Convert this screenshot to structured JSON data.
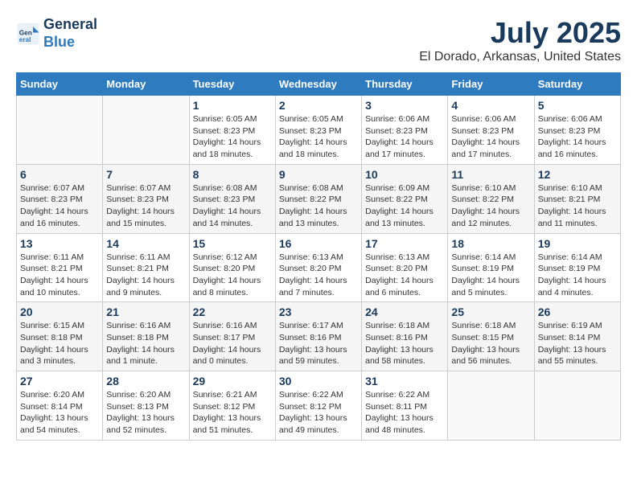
{
  "header": {
    "logo_line1": "General",
    "logo_line2": "Blue",
    "month": "July 2025",
    "location": "El Dorado, Arkansas, United States"
  },
  "weekdays": [
    "Sunday",
    "Monday",
    "Tuesday",
    "Wednesday",
    "Thursday",
    "Friday",
    "Saturday"
  ],
  "weeks": [
    [
      {
        "day": "",
        "info": ""
      },
      {
        "day": "",
        "info": ""
      },
      {
        "day": "1",
        "info": "Sunrise: 6:05 AM\nSunset: 8:23 PM\nDaylight: 14 hours and 18 minutes."
      },
      {
        "day": "2",
        "info": "Sunrise: 6:05 AM\nSunset: 8:23 PM\nDaylight: 14 hours and 18 minutes."
      },
      {
        "day": "3",
        "info": "Sunrise: 6:06 AM\nSunset: 8:23 PM\nDaylight: 14 hours and 17 minutes."
      },
      {
        "day": "4",
        "info": "Sunrise: 6:06 AM\nSunset: 8:23 PM\nDaylight: 14 hours and 17 minutes."
      },
      {
        "day": "5",
        "info": "Sunrise: 6:06 AM\nSunset: 8:23 PM\nDaylight: 14 hours and 16 minutes."
      }
    ],
    [
      {
        "day": "6",
        "info": "Sunrise: 6:07 AM\nSunset: 8:23 PM\nDaylight: 14 hours and 16 minutes."
      },
      {
        "day": "7",
        "info": "Sunrise: 6:07 AM\nSunset: 8:23 PM\nDaylight: 14 hours and 15 minutes."
      },
      {
        "day": "8",
        "info": "Sunrise: 6:08 AM\nSunset: 8:23 PM\nDaylight: 14 hours and 14 minutes."
      },
      {
        "day": "9",
        "info": "Sunrise: 6:08 AM\nSunset: 8:22 PM\nDaylight: 14 hours and 13 minutes."
      },
      {
        "day": "10",
        "info": "Sunrise: 6:09 AM\nSunset: 8:22 PM\nDaylight: 14 hours and 13 minutes."
      },
      {
        "day": "11",
        "info": "Sunrise: 6:10 AM\nSunset: 8:22 PM\nDaylight: 14 hours and 12 minutes."
      },
      {
        "day": "12",
        "info": "Sunrise: 6:10 AM\nSunset: 8:21 PM\nDaylight: 14 hours and 11 minutes."
      }
    ],
    [
      {
        "day": "13",
        "info": "Sunrise: 6:11 AM\nSunset: 8:21 PM\nDaylight: 14 hours and 10 minutes."
      },
      {
        "day": "14",
        "info": "Sunrise: 6:11 AM\nSunset: 8:21 PM\nDaylight: 14 hours and 9 minutes."
      },
      {
        "day": "15",
        "info": "Sunrise: 6:12 AM\nSunset: 8:20 PM\nDaylight: 14 hours and 8 minutes."
      },
      {
        "day": "16",
        "info": "Sunrise: 6:13 AM\nSunset: 8:20 PM\nDaylight: 14 hours and 7 minutes."
      },
      {
        "day": "17",
        "info": "Sunrise: 6:13 AM\nSunset: 8:20 PM\nDaylight: 14 hours and 6 minutes."
      },
      {
        "day": "18",
        "info": "Sunrise: 6:14 AM\nSunset: 8:19 PM\nDaylight: 14 hours and 5 minutes."
      },
      {
        "day": "19",
        "info": "Sunrise: 6:14 AM\nSunset: 8:19 PM\nDaylight: 14 hours and 4 minutes."
      }
    ],
    [
      {
        "day": "20",
        "info": "Sunrise: 6:15 AM\nSunset: 8:18 PM\nDaylight: 14 hours and 3 minutes."
      },
      {
        "day": "21",
        "info": "Sunrise: 6:16 AM\nSunset: 8:18 PM\nDaylight: 14 hours and 1 minute."
      },
      {
        "day": "22",
        "info": "Sunrise: 6:16 AM\nSunset: 8:17 PM\nDaylight: 14 hours and 0 minutes."
      },
      {
        "day": "23",
        "info": "Sunrise: 6:17 AM\nSunset: 8:16 PM\nDaylight: 13 hours and 59 minutes."
      },
      {
        "day": "24",
        "info": "Sunrise: 6:18 AM\nSunset: 8:16 PM\nDaylight: 13 hours and 58 minutes."
      },
      {
        "day": "25",
        "info": "Sunrise: 6:18 AM\nSunset: 8:15 PM\nDaylight: 13 hours and 56 minutes."
      },
      {
        "day": "26",
        "info": "Sunrise: 6:19 AM\nSunset: 8:14 PM\nDaylight: 13 hours and 55 minutes."
      }
    ],
    [
      {
        "day": "27",
        "info": "Sunrise: 6:20 AM\nSunset: 8:14 PM\nDaylight: 13 hours and 54 minutes."
      },
      {
        "day": "28",
        "info": "Sunrise: 6:20 AM\nSunset: 8:13 PM\nDaylight: 13 hours and 52 minutes."
      },
      {
        "day": "29",
        "info": "Sunrise: 6:21 AM\nSunset: 8:12 PM\nDaylight: 13 hours and 51 minutes."
      },
      {
        "day": "30",
        "info": "Sunrise: 6:22 AM\nSunset: 8:12 PM\nDaylight: 13 hours and 49 minutes."
      },
      {
        "day": "31",
        "info": "Sunrise: 6:22 AM\nSunset: 8:11 PM\nDaylight: 13 hours and 48 minutes."
      },
      {
        "day": "",
        "info": ""
      },
      {
        "day": "",
        "info": ""
      }
    ]
  ]
}
